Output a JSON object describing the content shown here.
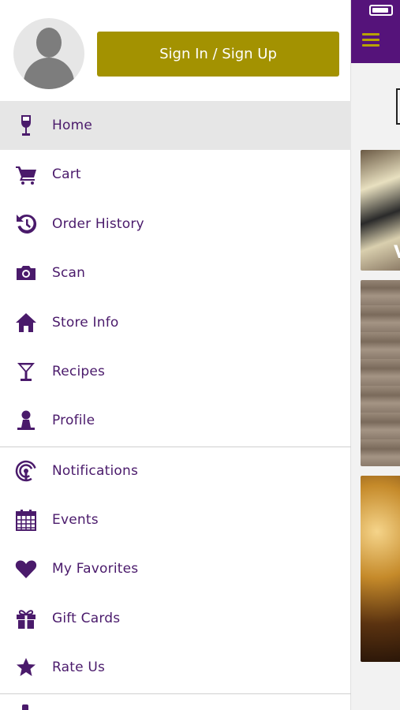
{
  "drawer": {
    "sign_in_label": "Sign In / Sign Up",
    "menu_group_1": [
      {
        "label": "Home",
        "icon": "wine-glass-icon"
      },
      {
        "label": "Cart",
        "icon": "cart-icon"
      },
      {
        "label": "Order History",
        "icon": "history-icon"
      },
      {
        "label": "Scan",
        "icon": "camera-icon"
      },
      {
        "label": "Store Info",
        "icon": "house-icon"
      },
      {
        "label": "Recipes",
        "icon": "cocktail-icon"
      },
      {
        "label": "Profile",
        "icon": "person-icon"
      }
    ],
    "menu_group_2": [
      {
        "label": "Notifications",
        "icon": "broadcast-icon"
      },
      {
        "label": "Events",
        "icon": "calendar-icon"
      },
      {
        "label": "My Favorites",
        "icon": "heart-icon"
      },
      {
        "label": "Gift Cards",
        "icon": "gift-icon"
      },
      {
        "label": "Rate Us",
        "icon": "star-icon"
      }
    ],
    "active_item": "Home"
  },
  "background_app": {
    "header_color": "#55137a",
    "card_letter": "V"
  },
  "colors": {
    "accent": "#a39201",
    "primary": "#4a1a6b",
    "active_bg": "#e6e6e6"
  }
}
